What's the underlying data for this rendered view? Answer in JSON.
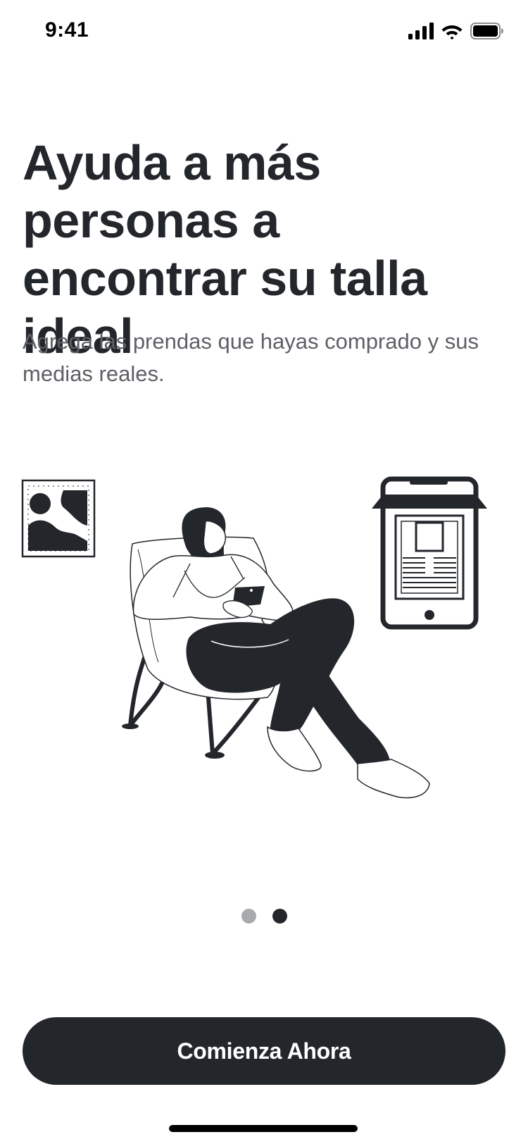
{
  "status_bar": {
    "time": "9:41",
    "icons": [
      "cellular-signal-icon",
      "wifi-icon",
      "battery-icon"
    ]
  },
  "onboarding": {
    "headline": "Ayuda a más personas a encontrar su talla ideal",
    "subtitle": "Agrega las prendas que hayas comprado y sus medias reales.",
    "illustration": "woman-on-chair-with-phone-illustration",
    "pager": {
      "total": 2,
      "active_index": 1
    },
    "cta_label": "Comienza Ahora"
  },
  "colors": {
    "primary": "#23262b",
    "text_secondary": "#5e6066",
    "dot_inactive": "#a9aaac",
    "background": "#ffffff"
  }
}
